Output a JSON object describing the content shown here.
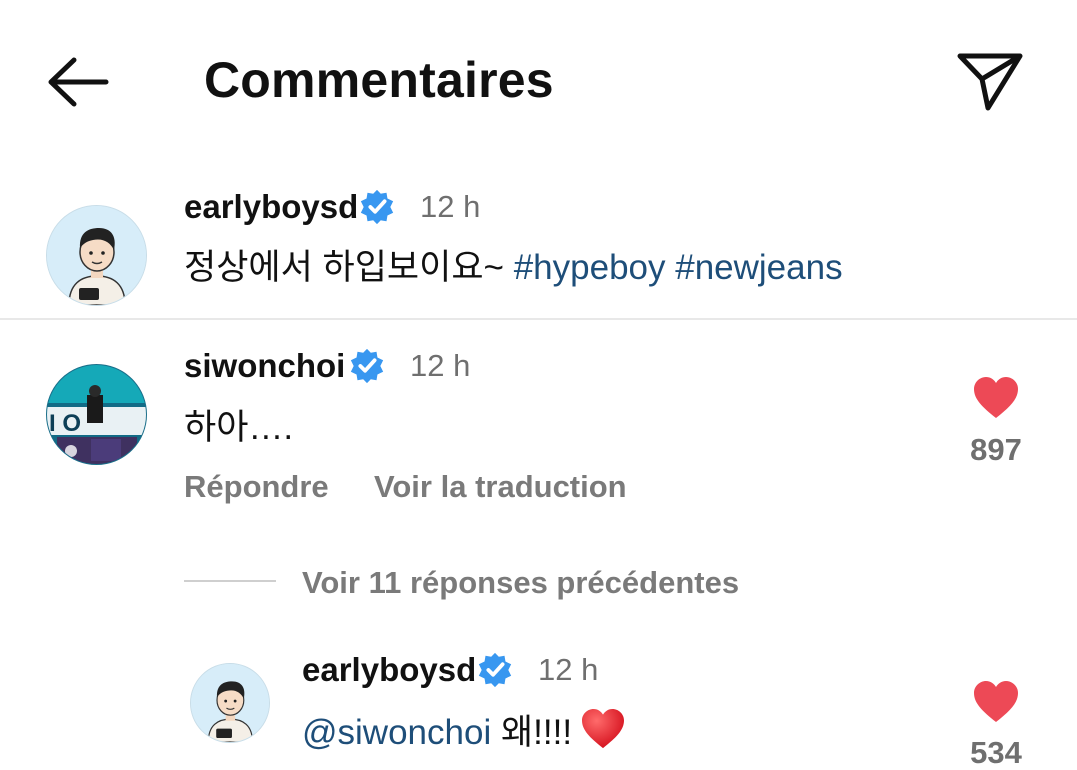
{
  "header": {
    "title": "Commentaires"
  },
  "comments": [
    {
      "username": "earlyboysd",
      "time": "12 h",
      "text_plain": "정상에서 하입보이요~ ",
      "hashtags": [
        "#hypeboy",
        "#newjeans"
      ]
    },
    {
      "username": "siwonchoi",
      "time": "12 h",
      "text": "하아….",
      "likes": "897",
      "reply_label": "Répondre",
      "translate_label": "Voir la traduction"
    }
  ],
  "replies": {
    "view_more_label": "Voir 11 réponses précédentes",
    "items": [
      {
        "username": "earlyboysd",
        "time": "12 h",
        "mention": "@siwonchoi",
        "text": " 왜!!!!",
        "likes": "534"
      }
    ]
  },
  "colors": {
    "like_red": "#ed4956",
    "verified_blue": "#3897f0",
    "link_blue": "#1e4e79"
  },
  "icons": {
    "back": "back-arrow-icon",
    "share": "paper-plane-icon",
    "verified": "verified-badge-icon",
    "like": "heart-icon"
  }
}
